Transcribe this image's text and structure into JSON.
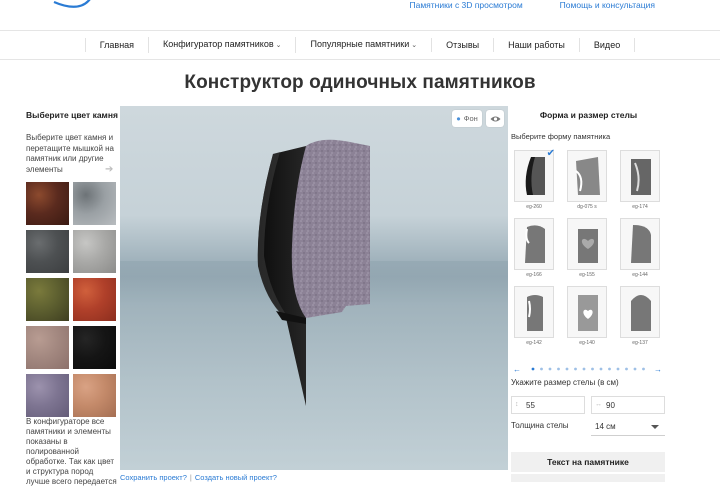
{
  "header": {
    "links": [
      "Памятники с 3D просмотром",
      "Помощь и консультация"
    ]
  },
  "nav": {
    "items": [
      {
        "label": "Главная",
        "dropdown": false
      },
      {
        "label": "Конфигуратор памятников",
        "dropdown": true
      },
      {
        "label": "Популярные памятники",
        "dropdown": true
      },
      {
        "label": "Отзывы",
        "dropdown": false
      },
      {
        "label": "Наши работы",
        "dropdown": false
      },
      {
        "label": "Видео",
        "dropdown": false
      }
    ]
  },
  "page": {
    "title": "Конструктор одиночных памятников"
  },
  "left_panel": {
    "title": "Выберите цвет камня",
    "description": "Выберите цвет камня и перетащите мышкой на памятник или другие элементы",
    "note": "В конфигураторе все памятники и элементы показаны в полированной обработке. Так как цвет и структура пород лучше всего передается",
    "swatches": [
      {
        "name": "stone-swatch-1",
        "colors": [
          "#5a2a1e",
          "#8c4a2e",
          "#3a1a12"
        ]
      },
      {
        "name": "stone-swatch-2",
        "colors": [
          "#9aa0a4",
          "#6d7377",
          "#b8bcbf"
        ]
      },
      {
        "name": "stone-swatch-3",
        "colors": [
          "#4d5052",
          "#6a6d6f",
          "#3c3e40"
        ]
      },
      {
        "name": "stone-swatch-4",
        "colors": [
          "#a9a9a7",
          "#c6c6c4",
          "#8c8c8a"
        ]
      },
      {
        "name": "stone-swatch-5",
        "colors": [
          "#5e6030",
          "#7a7a3c",
          "#3e3e20"
        ]
      },
      {
        "name": "stone-swatch-6",
        "colors": [
          "#b0402a",
          "#d0603c",
          "#8c2e1e"
        ]
      },
      {
        "name": "stone-swatch-7",
        "colors": [
          "#a38880",
          "#b89c92",
          "#8c716b"
        ]
      },
      {
        "name": "stone-swatch-8",
        "colors": [
          "#151515",
          "#252525",
          "#0b0b0b"
        ]
      },
      {
        "name": "stone-swatch-9",
        "colors": [
          "#7e7592",
          "#9c92ad",
          "#645c78"
        ]
      },
      {
        "name": "stone-swatch-10",
        "colors": [
          "#c48a6a",
          "#d9a284",
          "#a46e52"
        ]
      }
    ]
  },
  "viewer": {
    "bg_button_label": "Фон",
    "save_link": "Сохранить проект?",
    "new_link": "Создать новый проект?"
  },
  "right_panel": {
    "title": "Форма и размер стелы",
    "shape_label": "Выберите форму памятника",
    "shapes": [
      {
        "code": "eg-260",
        "selected": true
      },
      {
        "code": "dg-075 s",
        "selected": false
      },
      {
        "code": "eg-174",
        "selected": false
      },
      {
        "code": "eg-166",
        "selected": false
      },
      {
        "code": "eg-155",
        "selected": false
      },
      {
        "code": "eg-144",
        "selected": false
      },
      {
        "code": "eg-142",
        "selected": false
      },
      {
        "code": "eg-140",
        "selected": false
      },
      {
        "code": "eg-137",
        "selected": false
      }
    ],
    "pager_dots": 14,
    "pager_active": 0,
    "size_label": "Укажите размер стелы (в см)",
    "height_value": "55",
    "width_value": "90",
    "thickness_label": "Толщина стелы",
    "thickness_value": "14 см",
    "text_section": "Текст на памятнике"
  }
}
